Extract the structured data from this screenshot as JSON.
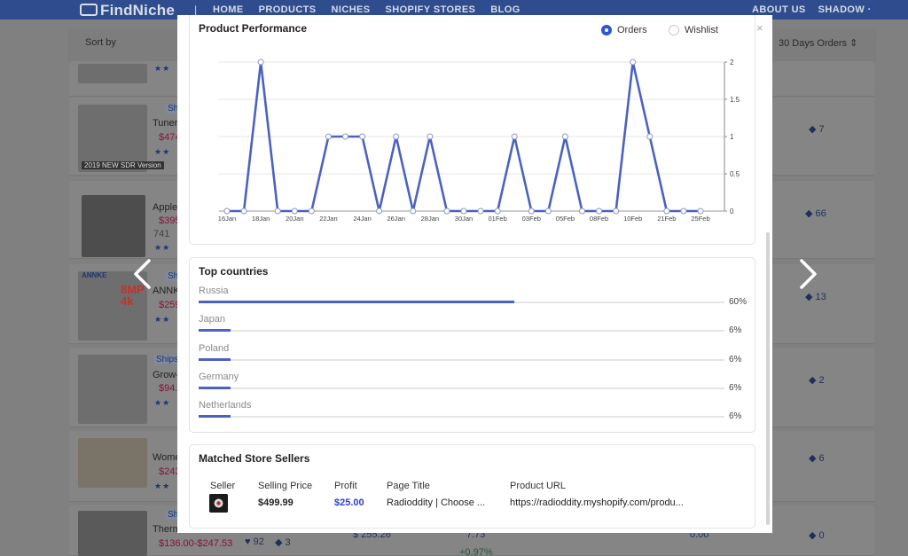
{
  "nav": {
    "logo": "FindNiche",
    "separator": "|",
    "links": [
      "HOME",
      "PRODUCTS",
      "NICHES",
      "SHOPIFY STORES",
      "BLOG"
    ],
    "about": "ABOUT US",
    "user": "SHADOW ·"
  },
  "filters": {
    "sort_label": "Sort by",
    "period_label": "30 Days Orders ⇕"
  },
  "background_products": [
    {
      "name": "",
      "price": "",
      "tag_count": ""
    },
    {
      "badge": "Sh",
      "name": "Tuner",
      "price": "$474",
      "tag_count": "7",
      "caption": "2019 NEW SDR Version"
    },
    {
      "badge": "",
      "name": "Apple",
      "price": "$395",
      "sub": "741",
      "tag_count": "66"
    },
    {
      "badge": "Sh",
      "name": "ANNK",
      "price": "$259",
      "tag_count": "13",
      "brand": "ANNKE",
      "thumb_text": "8MP 4k"
    },
    {
      "badge": "Ships",
      "name": "Grow-",
      "price": "$94.",
      "tag_count": "2"
    },
    {
      "badge": "",
      "name": "Wome",
      "price": "$243",
      "tag_count": "6"
    },
    {
      "badge": "Sh",
      "name": "Therm",
      "price": "$136.00-$247.53",
      "likes": "92",
      "tags": "3",
      "revenue": "$ 255.26",
      "share": "7.73",
      "growth": "+0.97%",
      "tag_count": "0",
      "amount": "0.00"
    }
  ],
  "modal": {
    "close": "×",
    "performance": {
      "title": "Product Performance",
      "toggle": {
        "orders": "Orders",
        "wishlist": "Wishlist",
        "selected": "orders"
      }
    },
    "countries": {
      "title": "Top countries",
      "items": [
        {
          "name": "Russia",
          "pct_label": "60%",
          "value": 60
        },
        {
          "name": "Japan",
          "pct_label": "6%",
          "value": 6
        },
        {
          "name": "Poland",
          "pct_label": "6%",
          "value": 6
        },
        {
          "name": "Germany",
          "pct_label": "6%",
          "value": 6
        },
        {
          "name": "Netherlands",
          "pct_label": "6%",
          "value": 6
        }
      ]
    },
    "sellers": {
      "title": "Matched Store Sellers",
      "headers": {
        "seller": "Seller",
        "price": "Selling Price",
        "profit": "Profit",
        "title": "Page Title",
        "url": "Product URL"
      },
      "row": {
        "price": "$499.99",
        "profit": "$25.00",
        "page_title": "Radioddity | Choose ...",
        "url": "https://radioddity.myshopify.com/produ..."
      }
    }
  },
  "colors": {
    "accent": "#2f55d4",
    "line": "#4a62c0",
    "profit": "#2b3fd1",
    "nav": "#2f4d8e"
  },
  "chart_data": {
    "type": "line",
    "title": "Product Performance",
    "series": [
      {
        "name": "Orders",
        "values": [
          0,
          0,
          2,
          0,
          0,
          0,
          1,
          1,
          1,
          0,
          1,
          0,
          1,
          0,
          0,
          0,
          0,
          1,
          0,
          0,
          1,
          0,
          0,
          0,
          2,
          1,
          0,
          0,
          0
        ]
      }
    ],
    "x_tick_labels": [
      "16Jan",
      "18Jan",
      "20Jan",
      "22Jan",
      "24Jan",
      "26Jan",
      "28Jan",
      "30Jan",
      "01Feb",
      "03Feb",
      "05Feb",
      "08Feb",
      "10Feb",
      "21Feb",
      "25Feb"
    ],
    "x_tick_index": [
      0,
      2,
      4,
      6,
      8,
      10,
      12,
      14,
      16,
      18,
      20,
      22,
      24,
      26,
      28
    ],
    "y_ticks": [
      "0",
      "0.5",
      "1",
      "1.5",
      "2"
    ],
    "ylim": [
      0,
      2
    ],
    "grid": true
  }
}
